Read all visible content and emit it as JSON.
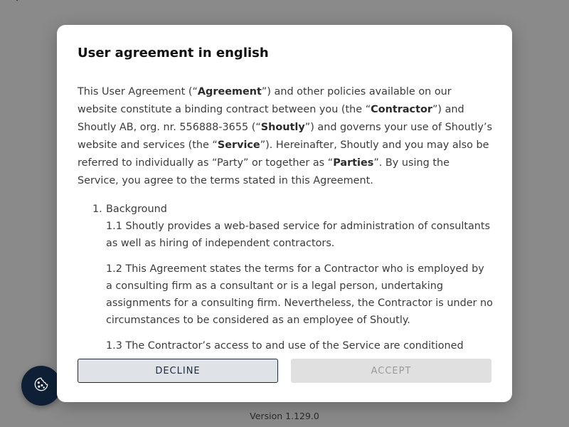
{
  "background": {
    "back_glyph": "‹",
    "version_text": "Version 1.129.0"
  },
  "cookie_button": {
    "icon": "cookie-icon"
  },
  "dialog": {
    "title": "User agreement in english",
    "intro": [
      {
        "t": "This User Agreement (“"
      },
      {
        "t": "Agreement",
        "b": true
      },
      {
        "t": "”) and other policies available on our website constitute a binding contract between you (the “"
      },
      {
        "t": "Contractor",
        "b": true
      },
      {
        "t": "”) and Shoutly AB, org. nr. 556888-3655 (“"
      },
      {
        "t": "Shoutly",
        "b": true
      },
      {
        "t": "”) and governs your use of Shoutly’s website and services (the “"
      },
      {
        "t": "Service",
        "b": true
      },
      {
        "t": "”). Hereinafter, Shoutly and you may also be referred to individually as “Party” or together as “"
      },
      {
        "t": "Parties",
        "b": true
      },
      {
        "t": "”. By using the Service, you agree to the terms stated in this Agreement."
      }
    ],
    "sections": [
      {
        "number": "1.",
        "heading": "Background",
        "clauses": [
          "1.1 Shoutly provides a web-based service for administration of consultants as well as hiring of independent contractors.",
          "1.2 This Agreement states the terms for a Contractor who is employed by a consulting firm as a consultant or is a legal person, undertaking assignments for a consulting firm. Nevertheless, the Contractor is under no circumstances to be considered as an employee of Shoutly.",
          "1.3 The Contractor’s access to and use of the Service are conditioned"
        ]
      }
    ],
    "decline_label": "DECLINE",
    "accept_label": "ACCEPT"
  },
  "colors": {
    "backdrop": "#8a8a8a",
    "cookie_button_bg": "#0f2036",
    "decline_border": "#1c2a3c",
    "decline_bg": "#dfe3e8",
    "accept_bg": "#e0e0e0",
    "accept_text": "#9a9a9a"
  }
}
